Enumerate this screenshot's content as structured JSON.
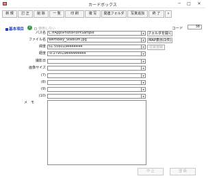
{
  "window": {
    "title": "カードボックス",
    "minimize": "─",
    "maximize": "□",
    "close": "✕"
  },
  "toolbar": [
    {
      "name": "new-button",
      "label": "新 規"
    },
    {
      "name": "edit-button",
      "label": "訂 正"
    },
    {
      "name": "delete-button",
      "label": "削 除"
    },
    {
      "name": "list-button",
      "label": "一 覧"
    },
    {
      "name": "print-button",
      "label": "印 刷"
    },
    {
      "name": "copy-button",
      "label": "複 写"
    },
    {
      "name": "related-folder-button",
      "label": "関連フォルダ"
    },
    {
      "name": "add-photo-button",
      "label": "写真追加"
    },
    {
      "name": "exit-button",
      "label": "終 了"
    },
    {
      "name": "more-button",
      "label": "»"
    }
  ],
  "form": {
    "section_label": "基本項目",
    "help_icon": "?",
    "unused_label": "使用しない",
    "code_label": "コード",
    "code_value": "38",
    "fields": [
      {
        "name": "path-field",
        "label": "パス名",
        "value": "C:¥AppliPhotoPlot¥Sample"
      },
      {
        "name": "filename-field",
        "label": "ファイル名",
        "value": "Wembley_Stadium.jpg"
      },
      {
        "name": "latitude-field",
        "label": "緯度",
        "value": "51.5560194444444"
      },
      {
        "name": "longitude-field",
        "label": "経度",
        "value": "-0.279519444444444"
      },
      {
        "name": "shooting-date-field",
        "label": "撮影日",
        "value": ""
      },
      {
        "name": "image-size-field",
        "label": "画像サイズ",
        "value": ""
      },
      {
        "name": "field-7",
        "label": "(7)",
        "value": ""
      },
      {
        "name": "field-8",
        "label": "(8)",
        "value": ""
      },
      {
        "name": "field-9",
        "label": "(9)",
        "value": ""
      },
      {
        "name": "field-10",
        "label": "(10)",
        "value": ""
      }
    ],
    "dropdown_glyph": "▾",
    "open_folder_label": "フォルダを開く",
    "map_display_label": "MAP表示(1件)",
    "position_register_label": "位置登録",
    "memo_label": "メ　モ"
  },
  "bottom": {
    "ok_label": "中 止",
    "cancel_label": "登 録"
  }
}
